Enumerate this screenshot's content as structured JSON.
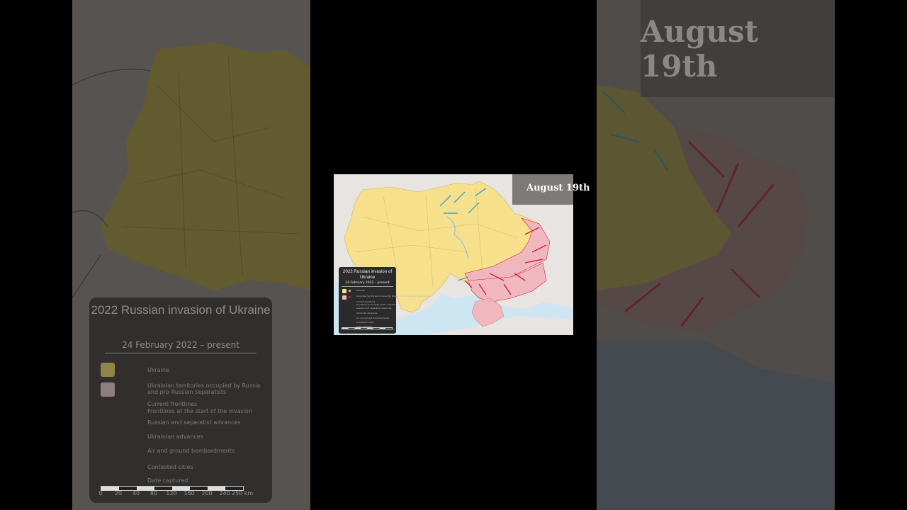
{
  "date_label": "August 19th",
  "legend": {
    "title": "2022 Russian invasion of Ukraine",
    "date_range": "24 February 2022 – present",
    "items": [
      "Ukraine",
      "Ukrainian territories occupied by Russia and pro-Russian separatists",
      "Current frontlines",
      "Frontlines at the start of the invasion",
      "Russian and separatist advances",
      "Ukrainian advances",
      "Air and ground bombardments",
      "Contested cities",
      "Date captured"
    ],
    "scale_ticks": [
      "0",
      "20",
      "40",
      "80",
      "120",
      "160",
      "200",
      "240",
      "250 km"
    ]
  },
  "colors": {
    "ukraine": "#f6e08c",
    "occupied": "#f0b8be",
    "sea": "#cde6f2",
    "advance_ru": "#d11f3c",
    "advance_ua": "#3aa7c4",
    "neighbors": "#e3dfdc"
  }
}
